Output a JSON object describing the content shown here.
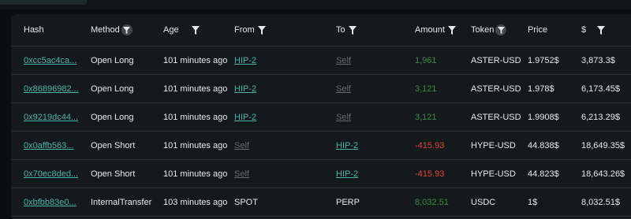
{
  "columns": {
    "hash": "Hash",
    "method": "Method",
    "age": "Age",
    "from": "From",
    "to": "To",
    "amount": "Amount",
    "token": "Token",
    "price": "Price",
    "usd": "$"
  },
  "rows": [
    {
      "hash": "0xcc5ac4ca...",
      "method": "Open Long",
      "age": "101 minutes ago",
      "from": "HIP-2",
      "to": "Self",
      "amount": "1,961",
      "token": "ASTER-USD",
      "price": "1.9752$",
      "usd": "3,873.3$"
    },
    {
      "hash": "0x86896982...",
      "method": "Open Long",
      "age": "101 minutes ago",
      "from": "HIP-2",
      "to": "Self",
      "amount": "3,121",
      "token": "ASTER-USD",
      "price": "1.978$",
      "usd": "6,173.45$"
    },
    {
      "hash": "0x9219dc44...",
      "method": "Open Long",
      "age": "101 minutes ago",
      "from": "HIP-2",
      "to": "Self",
      "amount": "3,121",
      "token": "ASTER-USD",
      "price": "1.9908$",
      "usd": "6,213.29$"
    },
    {
      "hash": "0x0affb563...",
      "method": "Open Short",
      "age": "101 minutes ago",
      "from": "Self",
      "to": "HIP-2",
      "amount": "-415.93",
      "token": "HYPE-USD",
      "price": "44.838$",
      "usd": "18,649.35$"
    },
    {
      "hash": "0x70ec8ded...",
      "method": "Open Short",
      "age": "101 minutes ago",
      "from": "Self",
      "to": "HIP-2",
      "amount": "-415.93",
      "token": "HYPE-USD",
      "price": "44.823$",
      "usd": "18,643.26$"
    },
    {
      "hash": "0xbfbb83e0...",
      "method": "InternalTransfer",
      "age": "103 minutes ago",
      "from": "SPOT",
      "to": "PERP",
      "amount": "8,032.51",
      "token": "USDC",
      "price": "1$",
      "usd": "8,032.51$"
    }
  ],
  "colors": {
    "link": "#4fb3a1",
    "muted": "#656c6e",
    "positive": "#3c8a49",
    "negative": "#e0443a",
    "panel": "#141a1b"
  },
  "icons": {
    "filter": "filter-icon",
    "filter_active": "filter-active-icon"
  }
}
